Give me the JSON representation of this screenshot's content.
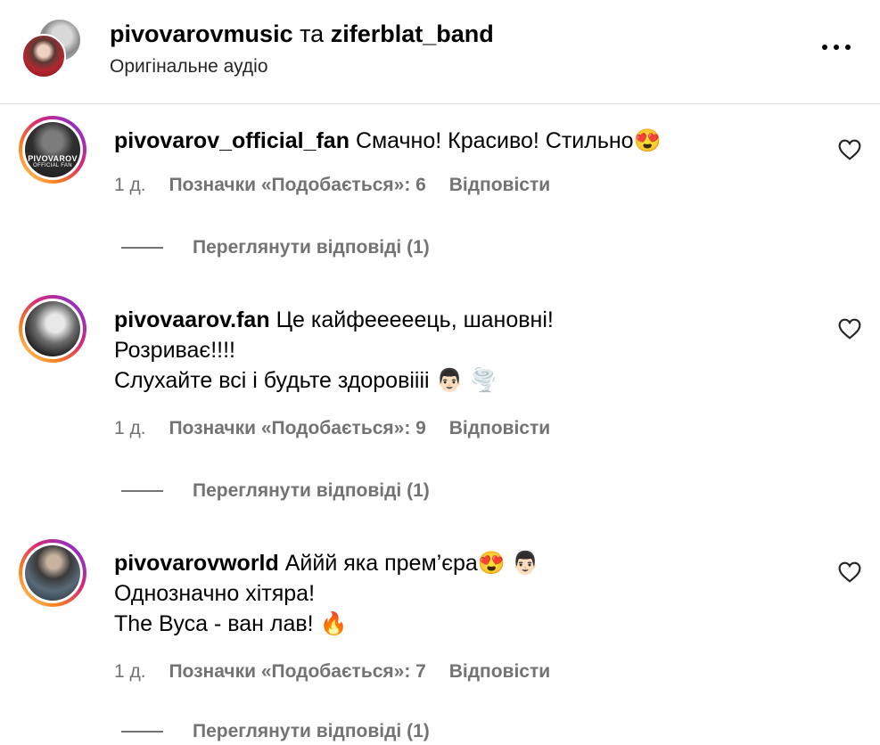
{
  "header": {
    "user1": "pivovarovmusic",
    "joiner": "та",
    "user2": "ziferblat_band",
    "subtitle": "Оригінальне аудіо"
  },
  "comments": [
    {
      "username": "pivovarov_official_fan",
      "lines": [
        "Смачно! Красиво! Стильно😍"
      ],
      "avatar_text": [
        "PIVOVAROV",
        "OFFICIAL FAN"
      ],
      "age": "1 д.",
      "likes": "Позначки «Подобається»: 6",
      "reply": "Відповісти",
      "view_replies": "Переглянути відповіді (1)"
    },
    {
      "username": "pivovaarov.fan",
      "lines": [
        "Це кайфееееець, шановні!",
        "Розриває!!!!",
        "Слухайте всі і будьте здоровіііі 👨🏻 🌪️"
      ],
      "age": "1 д.",
      "likes": "Позначки «Подобається»: 9",
      "reply": "Відповісти",
      "view_replies": "Переглянути відповіді (1)"
    },
    {
      "username": "pivovarovworld",
      "lines": [
        "Аййй яка прем’єра😍 👨🏻",
        "Однозначно хітяра!",
        "The Вуса - ван лав! 🔥"
      ],
      "age": "1 д.",
      "likes": "Позначки «Подобається»: 7",
      "reply": "Відповісти",
      "view_replies": "Переглянути відповіді (1)"
    }
  ],
  "icons": {
    "more": "more-horizontal-icon",
    "like": "heart-outline-icon"
  }
}
